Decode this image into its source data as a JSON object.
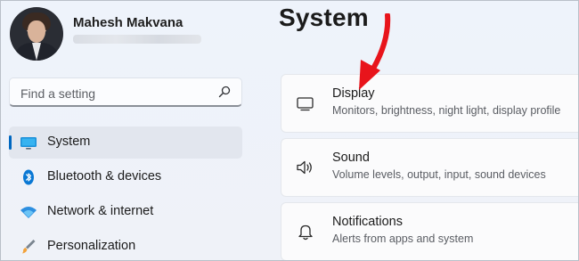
{
  "profile": {
    "name": "Mahesh Makvana"
  },
  "search": {
    "placeholder": "Find a setting"
  },
  "sidebar": {
    "items": [
      {
        "label": "System",
        "icon": "system-icon",
        "selected": true
      },
      {
        "label": "Bluetooth & devices",
        "icon": "bluetooth-icon"
      },
      {
        "label": "Network & internet",
        "icon": "wifi-icon"
      },
      {
        "label": "Personalization",
        "icon": "brush-icon"
      }
    ]
  },
  "main": {
    "title": "System",
    "cards": [
      {
        "title": "Display",
        "desc": "Monitors, brightness, night light, display profile",
        "icon": "monitor-icon"
      },
      {
        "title": "Sound",
        "desc": "Volume levels, output, input, sound devices",
        "icon": "speaker-icon"
      },
      {
        "title": "Notifications",
        "desc": "Alerts from apps and system",
        "icon": "bell-icon"
      }
    ]
  },
  "colors": {
    "accent": "#0067c0",
    "annotation_arrow": "#e8141b",
    "background": "#eef2f9"
  }
}
